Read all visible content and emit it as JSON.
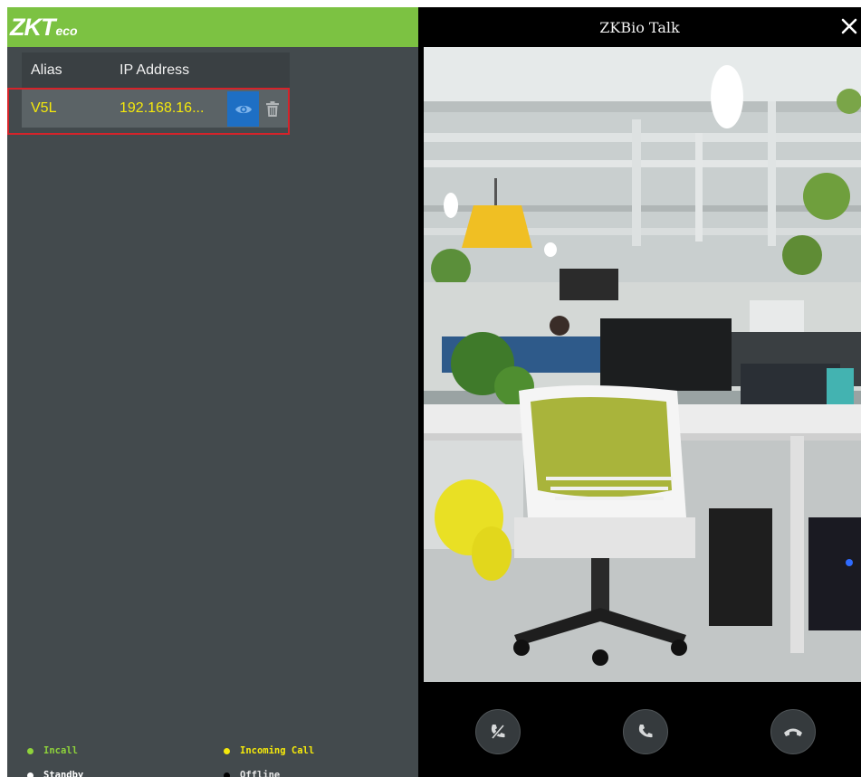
{
  "brand": {
    "logo_main": "ZKT",
    "logo_sub": "eco",
    "accent_color": "#7cc242"
  },
  "device_table": {
    "headers": {
      "alias": "Alias",
      "ip": "IP Address"
    },
    "rows": [
      {
        "alias": "V5L",
        "ip": "192.168.16...",
        "view_icon": "eye-icon",
        "delete_icon": "trash-icon"
      }
    ],
    "selected_row_color": "#f5e90b",
    "highlight_color": "#d6232a"
  },
  "legend": {
    "incall": {
      "label": "Incall",
      "color": "#8ed23b"
    },
    "incoming": {
      "label": "Incoming Call",
      "color": "#f5e90b"
    },
    "standby": {
      "label": "Standby",
      "color": "#ffffff"
    },
    "offline": {
      "label": "Offline",
      "color": "#000000"
    }
  },
  "talk_window": {
    "title": "ZKBio Talk",
    "close_icon": "close-icon",
    "video_icon": "camera-feed-icon",
    "controls": [
      {
        "name": "mute-call-button",
        "icon": "phone-slash-icon"
      },
      {
        "name": "answer-call-button",
        "icon": "phone-icon"
      },
      {
        "name": "hang-up-button",
        "icon": "phone-hangup-icon"
      }
    ]
  }
}
